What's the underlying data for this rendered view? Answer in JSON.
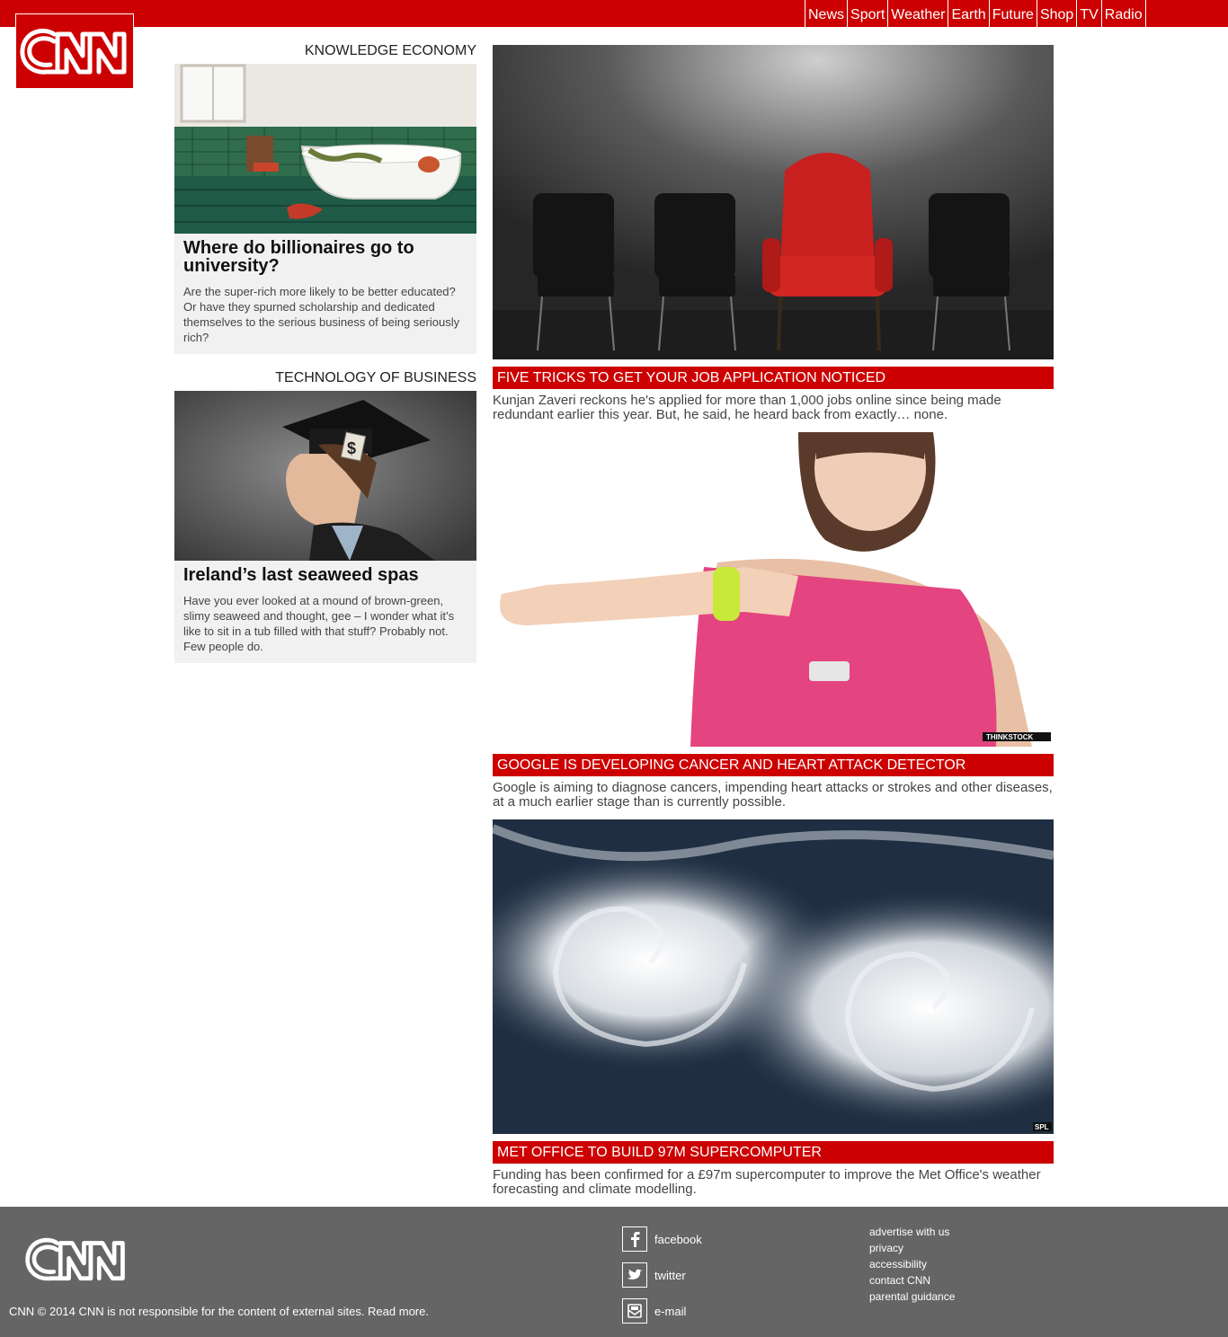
{
  "nav": {
    "items": [
      "News",
      "Sport",
      "Weather",
      "Earth",
      "Future",
      "Shop",
      "TV",
      "Radio"
    ]
  },
  "brand": {
    "name": "CNN",
    "accent": "#cc0000"
  },
  "sidebar": {
    "sections": [
      {
        "label": "KNOWLEDGE ECONOMY",
        "title": "Where do billionaires go to university?",
        "summary": "Are the super-rich more likely to be better educated? Or have they spurned scholarship and dedicated themselves to the serious business of being seriously rich?"
      },
      {
        "label": "TECHNOLOGY OF BUSINESS",
        "title": "Ireland’s last seaweed spas",
        "summary": "Have you ever looked at a mound of brown-green, slimy seaweed and thought, gee – I wonder what it’s like to sit in a tub filled with that stuff? Probably not. Few people do."
      }
    ]
  },
  "main": {
    "stories": [
      {
        "headline": "FIVE TRICKS TO GET YOUR JOB APPLICATION NOTICED",
        "summary": "Kunjan Zaveri reckons he's applied for more than 1,000 jobs online since being made redundant earlier this year. But, he said, he heard back from exactly… none."
      },
      {
        "headline": "GOOGLE IS DEVELOPING CANCER AND HEART ATTACK DETECTOR",
        "summary": "Google is aiming to diagnose cancers, impending heart attacks or strokes and other diseases, at a much earlier stage than is currently possible.",
        "image_credit": "THINKSTOCK"
      },
      {
        "headline": "MET OFFICE TO BUILD 97M SUPERCOMPUTER",
        "summary": "Funding has been confirmed for a £97m supercomputer to improve the Met Office's weather forecasting and climate modelling.",
        "image_credit": "SPL"
      }
    ]
  },
  "footer": {
    "copyright": "CNN © 2014 CNN is not responsible for the content of external sites. Read more.",
    "social": [
      {
        "label": "facebook",
        "icon": "facebook-icon"
      },
      {
        "label": "twitter",
        "icon": "twitter-icon"
      },
      {
        "label": "e-mail",
        "icon": "email-icon"
      }
    ],
    "links": [
      "advertise with us",
      "privacy",
      "accessibility",
      "contact CNN",
      "parental guidance"
    ]
  }
}
